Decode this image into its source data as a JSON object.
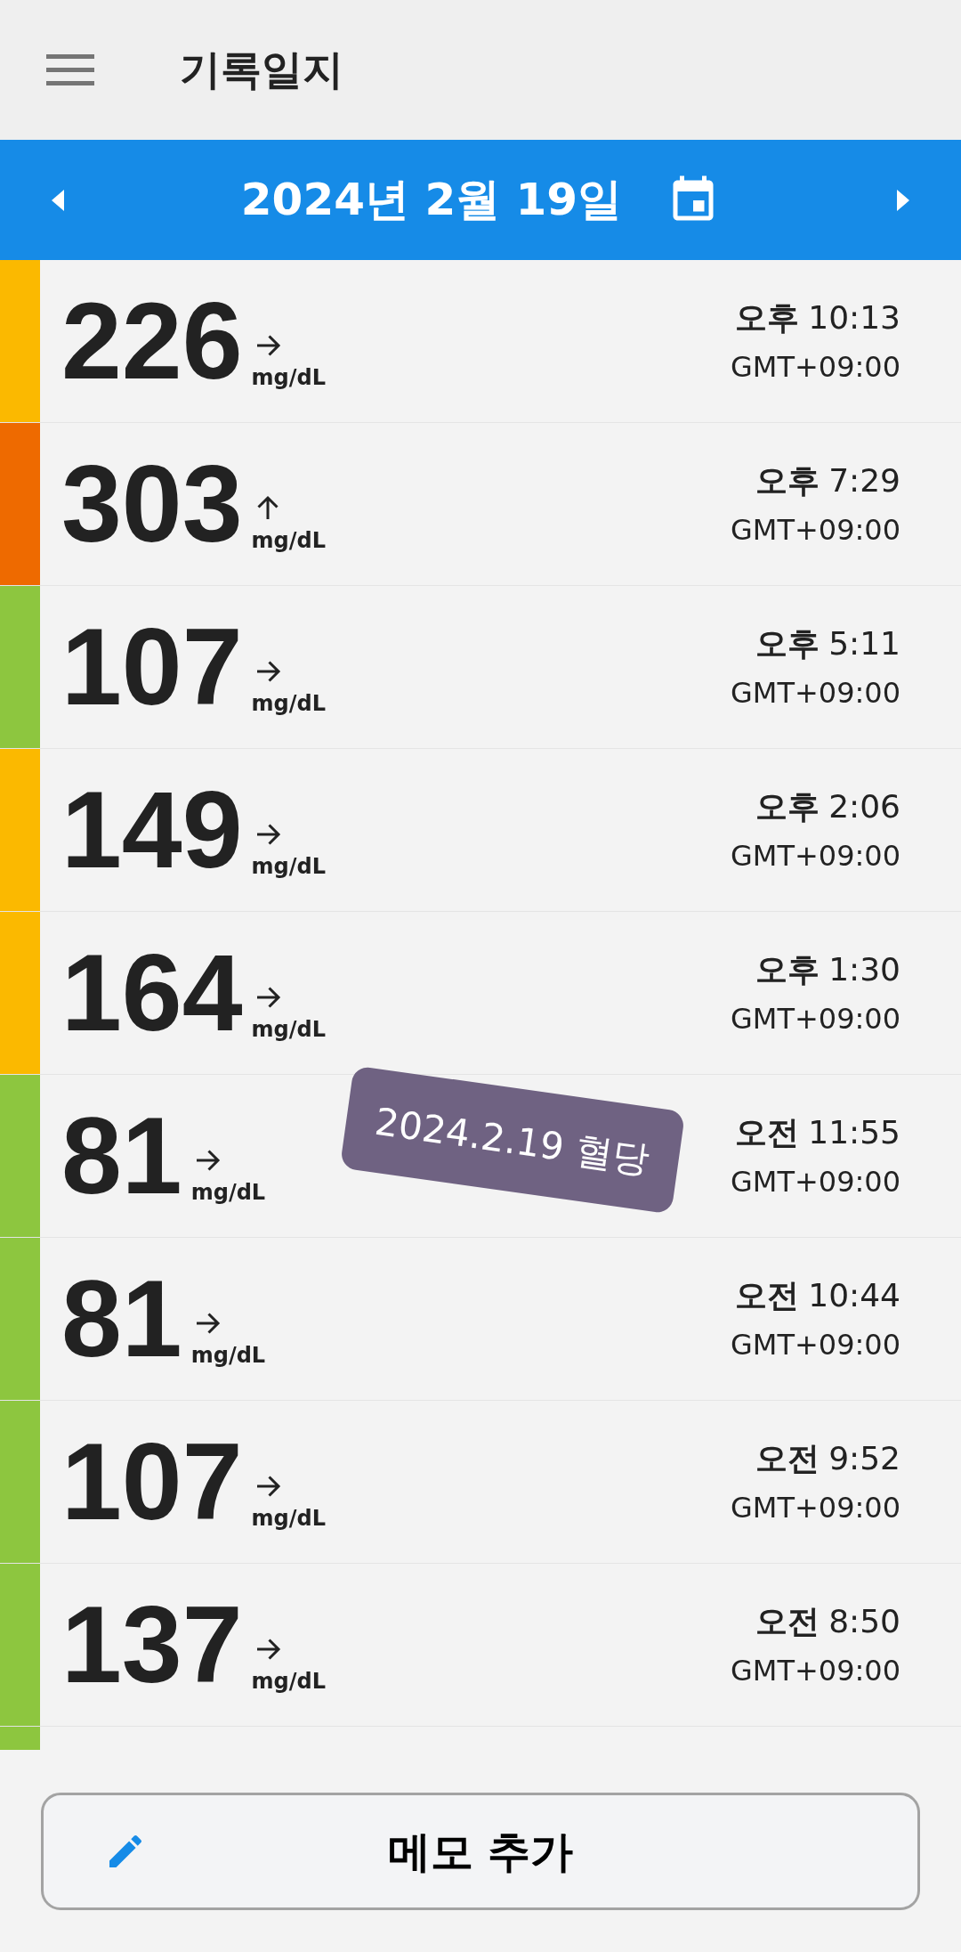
{
  "app_bar": {
    "title": "기록일지"
  },
  "date_bar": {
    "date": "2024년 2월 19일"
  },
  "readings": [
    {
      "value": "226",
      "kind": "steady",
      "unit": "mg/dL",
      "period": "오후",
      "time": "10:13",
      "timezone": "GMT+09:00",
      "color": "#fbb900"
    },
    {
      "value": "303",
      "kind": "rising",
      "unit": "mg/dL",
      "period": "오후",
      "time": "7:29",
      "timezone": "GMT+09:00",
      "color": "#ee6a00"
    },
    {
      "value": "107",
      "kind": "steady",
      "unit": "mg/dL",
      "period": "오후",
      "time": "5:11",
      "timezone": "GMT+09:00",
      "color": "#8dc63f"
    },
    {
      "value": "149",
      "kind": "steady",
      "unit": "mg/dL",
      "period": "오후",
      "time": "2:06",
      "timezone": "GMT+09:00",
      "color": "#fbb900"
    },
    {
      "value": "164",
      "kind": "steady",
      "unit": "mg/dL",
      "period": "오후",
      "time": "1:30",
      "timezone": "GMT+09:00",
      "color": "#fbb900"
    },
    {
      "value": "81",
      "kind": "steady",
      "unit": "mg/dL",
      "period": "오전",
      "time": "11:55",
      "timezone": "GMT+09:00",
      "color": "#8dc63f"
    },
    {
      "value": "81",
      "kind": "steady",
      "unit": "mg/dL",
      "period": "오전",
      "time": "10:44",
      "timezone": "GMT+09:00",
      "color": "#8dc63f"
    },
    {
      "value": "107",
      "kind": "steady",
      "unit": "mg/dL",
      "period": "오전",
      "time": "9:52",
      "timezone": "GMT+09:00",
      "color": "#8dc63f"
    },
    {
      "value": "137",
      "kind": "steady",
      "unit": "mg/dL",
      "period": "오전",
      "time": "8:50",
      "timezone": "GMT+09:00",
      "color": "#8dc63f"
    }
  ],
  "next_row": {
    "color": "#8dc63f"
  },
  "sticker": {
    "text": "2024.2.19 혈당"
  },
  "add_memo_button": {
    "label": "메모 추가"
  }
}
